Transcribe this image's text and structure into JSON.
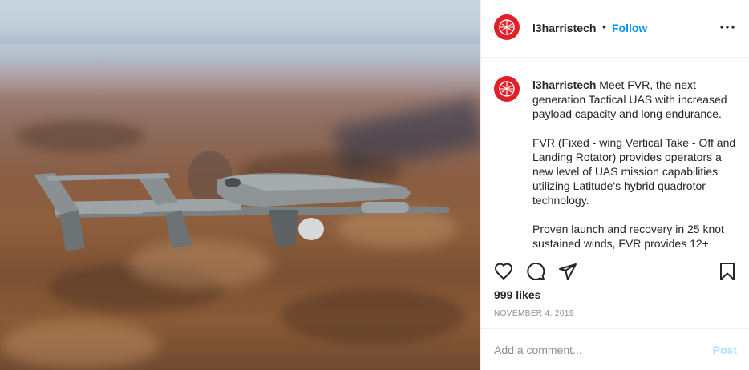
{
  "post": {
    "image_alt": "FVR fixed-wing vertical take-off drone flying over desert mountains",
    "header": {
      "username": "l3harristech",
      "separator": "•",
      "follow_label": "Follow",
      "more_icon": "more-horizontal-icon"
    },
    "caption": {
      "username": "l3harristech",
      "paragraphs": [
        "Meet FVR, the next generation Tactical UAS with increased payload capacity and long endurance.",
        "FVR (Fixed - wing Vertical Take - Off and Landing Rotator) provides operators a new level of UAS mission capabilities utilizing Latitude's hybrid quadrotor technology.",
        "Proven launch and recovery in 25 knot sustained winds, FVR provides 12+"
      ]
    },
    "actions": {
      "like_icon": "heart-icon",
      "comment_icon": "comment-icon",
      "share_icon": "paper-plane-icon",
      "save_icon": "bookmark-icon"
    },
    "likes_text": "999 likes",
    "date_text": "NOVEMBER 4, 2019",
    "comment": {
      "placeholder": "Add a comment...",
      "post_label": "Post"
    },
    "colors": {
      "brand_avatar": "#e0202a",
      "follow": "#0095f6",
      "post_disabled": "#b2dffc",
      "muted": "#8e8e8e"
    }
  }
}
